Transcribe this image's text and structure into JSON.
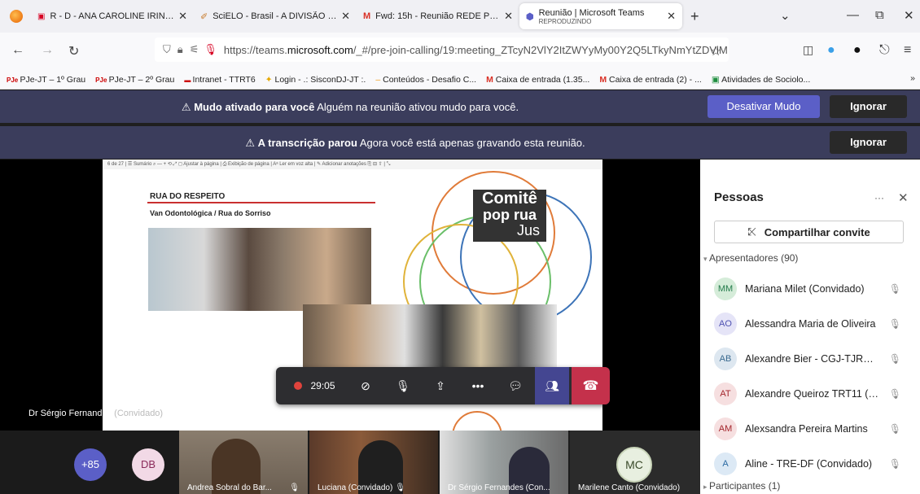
{
  "browser": {
    "tabs": [
      {
        "title": "R - D - ANA CAROLINE IRINEU.pdf",
        "icon": "firefox-pdf-icon"
      },
      {
        "title": "SciELO - Brasil - A DIVISÃO SOC",
        "icon": "scielo-icon"
      },
      {
        "title": "Fwd: 15h - Reunião REDE POPR",
        "icon": "gmail-icon"
      },
      {
        "title": "Reunião | Microsoft Teams",
        "subtitle": "REPRODUZINDO",
        "icon": "teams-icon"
      }
    ],
    "url_prefix": "https://teams.",
    "url_domain": "microsoft.com",
    "url_rest": "/_#/pre-join-calling/19:meeting_ZTcyN2VlY2ItZWYyMy00Y2Q5LTkyNmYtZDVlM",
    "bookmarks": [
      "PJe-JT – 1º Grau",
      "PJe-JT – 2º Grau",
      "Intranet - TTRT6",
      "Login - .: SisconDJ-JT :.",
      "Conteúdos - Desafio C...",
      "Caixa de entrada (1.35...",
      "Caixa de entrada (2) - ...",
      "Atividades de Sociolo..."
    ]
  },
  "banners": {
    "mute": {
      "strong": "Mudo ativado para você",
      "text": " Alguém na reunião ativou mudo para você.",
      "action": "Desativar Mudo",
      "dismiss": "Ignorar"
    },
    "transcript": {
      "strong": "A transcrição parou",
      "text": " Agora você está apenas gravando esta reunião.",
      "dismiss": "Ignorar"
    }
  },
  "slide": {
    "pdf_toolbar": "6   de 27  |  ☰ Sumário   ⌕             —   +   ⟲  ⤢   ◻ Ajustar à página  |  ⎙ Exibição de página  |  Aᵃ Ler em voz alta  |  ✎ Adicionar anotações   ⎘   ⊟   ⇧  |  ⤡",
    "title": "RUA DO RESPEITO",
    "subtitle": "Van Odontológica / Rua do Sorriso",
    "logo_line1": "Comitê",
    "logo_line2": "pop rua",
    "logo_line3": "Jus"
  },
  "presenter": {
    "name": "Dr Sérgio Fernandes",
    "role": "(Convidado)"
  },
  "controls": {
    "timer": "29:05"
  },
  "people_panel": {
    "title": "Pessoas",
    "share_label": "Compartilhar convite",
    "presenters_header": "Apresentadores (90)",
    "participants_header": "Participantes (1)",
    "presenters": [
      {
        "initials": "MM",
        "name": "Mariana Milet (Convidado)",
        "bg": "#d5ecd9",
        "fg": "#237b4b"
      },
      {
        "initials": "AO",
        "name": "Alessandra Maria de Oliveira",
        "bg": "#e5e4f7",
        "fg": "#4f52b2"
      },
      {
        "initials": "AB",
        "name": "Alexandre Bier - CGJ-TJRS (C...",
        "bg": "#dde7f0",
        "fg": "#3a6a8f"
      },
      {
        "initials": "AT",
        "name": "Alexandre Queiroz TRT11 (C...",
        "bg": "#f6dfe0",
        "fg": "#a4262c"
      },
      {
        "initials": "AM",
        "name": "Alexsandra Pereira Martins",
        "bg": "#f6dfe0",
        "fg": "#a4262c"
      },
      {
        "initials": "A",
        "name": "Aline - TRE-DF (Convidado)",
        "bg": "#dce9f5",
        "fg": "#2b6aa3"
      }
    ]
  },
  "strip": {
    "overflow_count": "+85",
    "db_initials": "DB",
    "mc_initials": "MC",
    "tiles": [
      "Andrea Sobral do Bar...",
      "Luciana (Convidado)",
      "Dr Sérgio Fernandes (Con...",
      "Marilene Canto (Convidado)"
    ]
  }
}
